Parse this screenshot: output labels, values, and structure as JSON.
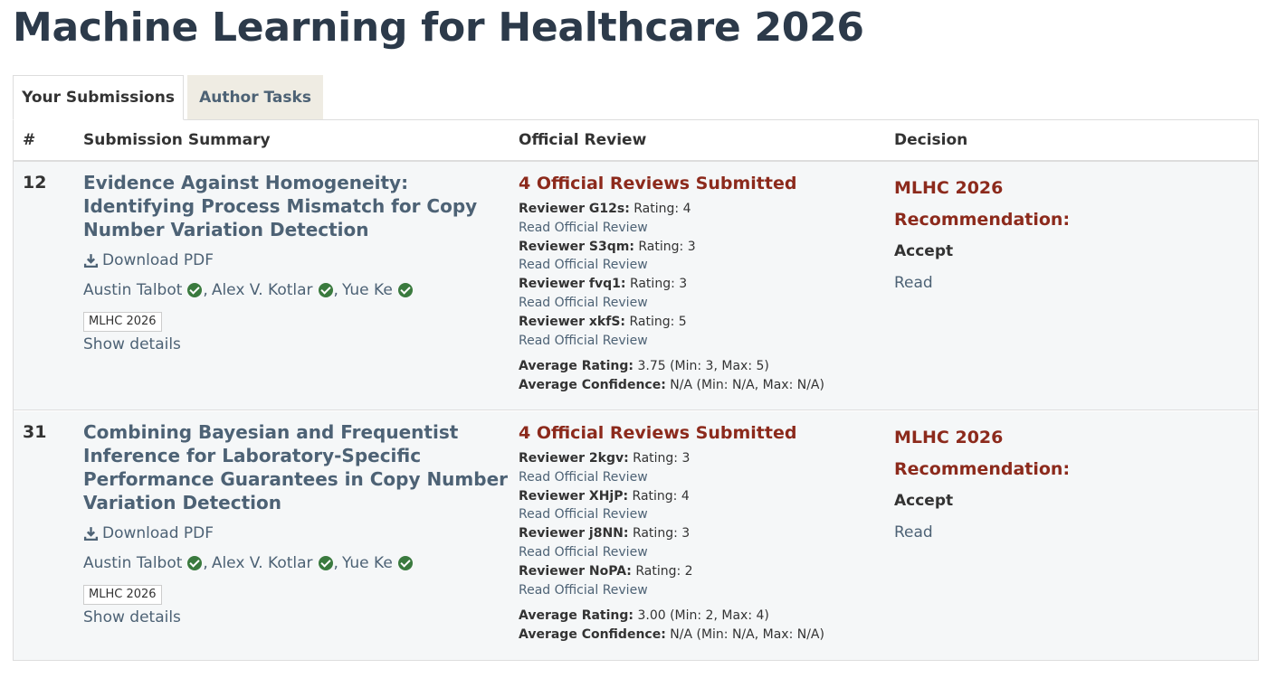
{
  "venue_title": "Machine Learning for Healthcare 2026",
  "tabs": [
    {
      "label": "Your Submissions",
      "active": true
    },
    {
      "label": "Author Tasks",
      "active": false
    }
  ],
  "table": {
    "headers": {
      "number": "#",
      "summary": "Submission Summary",
      "review": "Official Review",
      "decision": "Decision"
    }
  },
  "submissions": [
    {
      "number": "12",
      "title": "Evidence Against Homogeneity: Identifying Process Mismatch for Copy Number Variation Detection",
      "download_label": "Download PDF",
      "authors": [
        "Austin Talbot",
        "Alex V. Kotlar",
        "Yue Ke"
      ],
      "venue_badge": "MLHC 2026",
      "show_details": "Show details",
      "reviews_heading": "4 Official Reviews Submitted",
      "reviews": [
        {
          "reviewer": "Reviewer G12s:",
          "rating": "Rating: 4",
          "link": "Read Official Review"
        },
        {
          "reviewer": "Reviewer S3qm:",
          "rating": "Rating: 3",
          "link": "Read Official Review"
        },
        {
          "reviewer": "Reviewer fvq1:",
          "rating": "Rating: 3",
          "link": "Read Official Review"
        },
        {
          "reviewer": "Reviewer xkfS:",
          "rating": "Rating: 5",
          "link": "Read Official Review"
        }
      ],
      "avg_rating_label": "Average Rating:",
      "avg_rating_value": "3.75 (Min: 3, Max: 5)",
      "avg_conf_label": "Average Confidence:",
      "avg_conf_value": "N/A (Min: N/A, Max: N/A)",
      "decision_line1": "MLHC 2026",
      "decision_line2": "Recommendation:",
      "decision_value": "Accept",
      "decision_read": "Read"
    },
    {
      "number": "31",
      "title": "Combining Bayesian and Frequentist Inference for Laboratory-Specific Performance Guarantees in Copy Number Variation Detection",
      "download_label": "Download PDF",
      "authors": [
        "Austin Talbot",
        "Alex V. Kotlar",
        "Yue Ke"
      ],
      "venue_badge": "MLHC 2026",
      "show_details": "Show details",
      "reviews_heading": "4 Official Reviews Submitted",
      "reviews": [
        {
          "reviewer": "Reviewer 2kgv:",
          "rating": "Rating: 3",
          "link": "Read Official Review"
        },
        {
          "reviewer": "Reviewer XHjP:",
          "rating": "Rating: 4",
          "link": "Read Official Review"
        },
        {
          "reviewer": "Reviewer j8NN:",
          "rating": "Rating: 3",
          "link": "Read Official Review"
        },
        {
          "reviewer": "Reviewer NoPA:",
          "rating": "Rating: 2",
          "link": "Read Official Review"
        }
      ],
      "avg_rating_label": "Average Rating:",
      "avg_rating_value": "3.00 (Min: 2, Max: 4)",
      "avg_conf_label": "Average Confidence:",
      "avg_conf_value": "N/A (Min: N/A, Max: N/A)",
      "decision_line1": "MLHC 2026",
      "decision_line2": "Recommendation:",
      "decision_value": "Accept",
      "decision_read": "Read"
    }
  ],
  "colors": {
    "title": "#2c3a4a",
    "link": "#4d6275",
    "accent_red": "#8c2a1c",
    "row_bg": "#f5f7f8",
    "verified_green": "#3a7a3e",
    "inactive_tab_bg": "#efece3"
  },
  "icons": {
    "download": "download-icon",
    "verified": "verified-check-icon"
  }
}
